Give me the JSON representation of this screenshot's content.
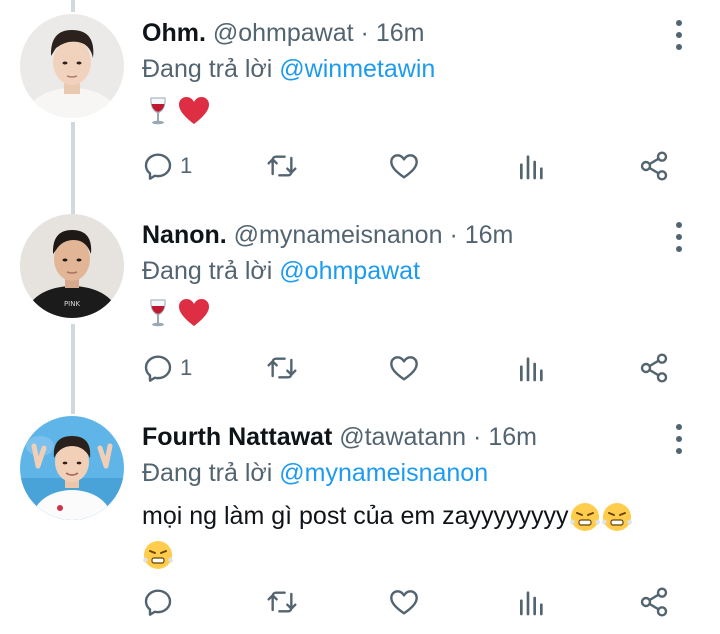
{
  "tweets": [
    {
      "name": "Ohm.",
      "handle": "@ohmpawat",
      "dot": "·",
      "time": "16m",
      "reply_prefix": "Đang trả lời",
      "reply_to": "@winmetawin",
      "text": "",
      "emojis": [
        "wine-glass-emoji",
        "red-heart-emoji"
      ],
      "reply_count": "1"
    },
    {
      "name": "Nanon.",
      "handle": "@mynameisnanon",
      "dot": "·",
      "time": "16m",
      "reply_prefix": "Đang trả lời",
      "reply_to": "@ohmpawat",
      "text": "",
      "emojis": [
        "wine-glass-emoji",
        "red-heart-emoji"
      ],
      "reply_count": "1"
    },
    {
      "name": "Fourth Nattawat",
      "handle": "@tawatann",
      "dot": "·",
      "time": "16m",
      "reply_prefix": "Đang trả lời",
      "reply_to": "@mynameisnanon",
      "text": "mọi ng làm gì post của em zayyyyyyyy",
      "emojis": [
        "face-with-steam-emoji",
        "face-with-steam-emoji",
        "face-with-steam-emoji"
      ],
      "reply_count": ""
    }
  ],
  "colors": {
    "text": "#0f1419",
    "secondary": "#536471",
    "link": "#1d9bf0",
    "heart": "#dd2e44",
    "thread_line": "#cfd9de"
  },
  "icons": [
    "reply-icon",
    "retweet-icon",
    "like-icon",
    "analytics-icon",
    "share-icon",
    "more-icon"
  ]
}
